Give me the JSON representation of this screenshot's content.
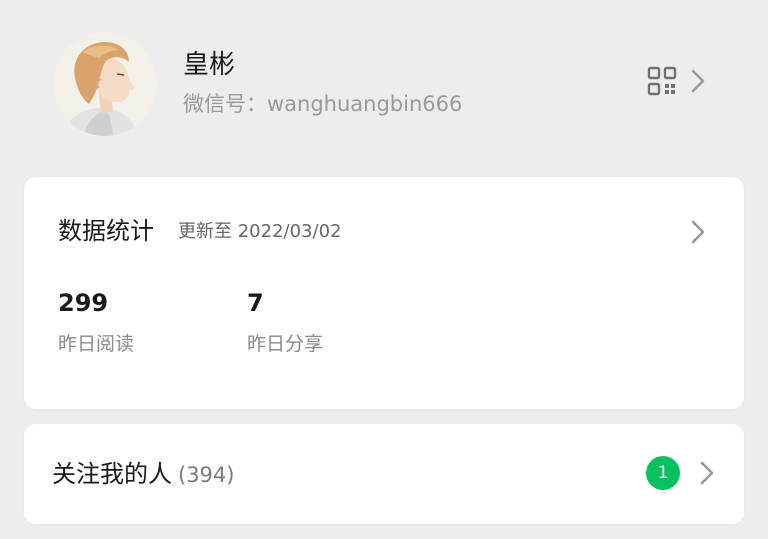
{
  "profile": {
    "name": "皇彬",
    "wechat_id": "微信号：wanghuangbin666",
    "avatar_icon": "avatar-illustration",
    "qr_icon": "qr-code-icon",
    "arrow_icon": "chevron-right-icon"
  },
  "stats": {
    "title": "数据统计",
    "updated": "更新至 2022/03/02",
    "metrics": [
      {
        "value": "299",
        "label": "昨日阅读"
      },
      {
        "value": "7",
        "label": "昨日分享"
      }
    ]
  },
  "followers": {
    "label": "关注我的人",
    "count": "(394)",
    "badge": "1",
    "badge_color": "#07c160"
  },
  "colors": {
    "background": "#ededed",
    "card": "#ffffff",
    "accent": "#07c160"
  }
}
